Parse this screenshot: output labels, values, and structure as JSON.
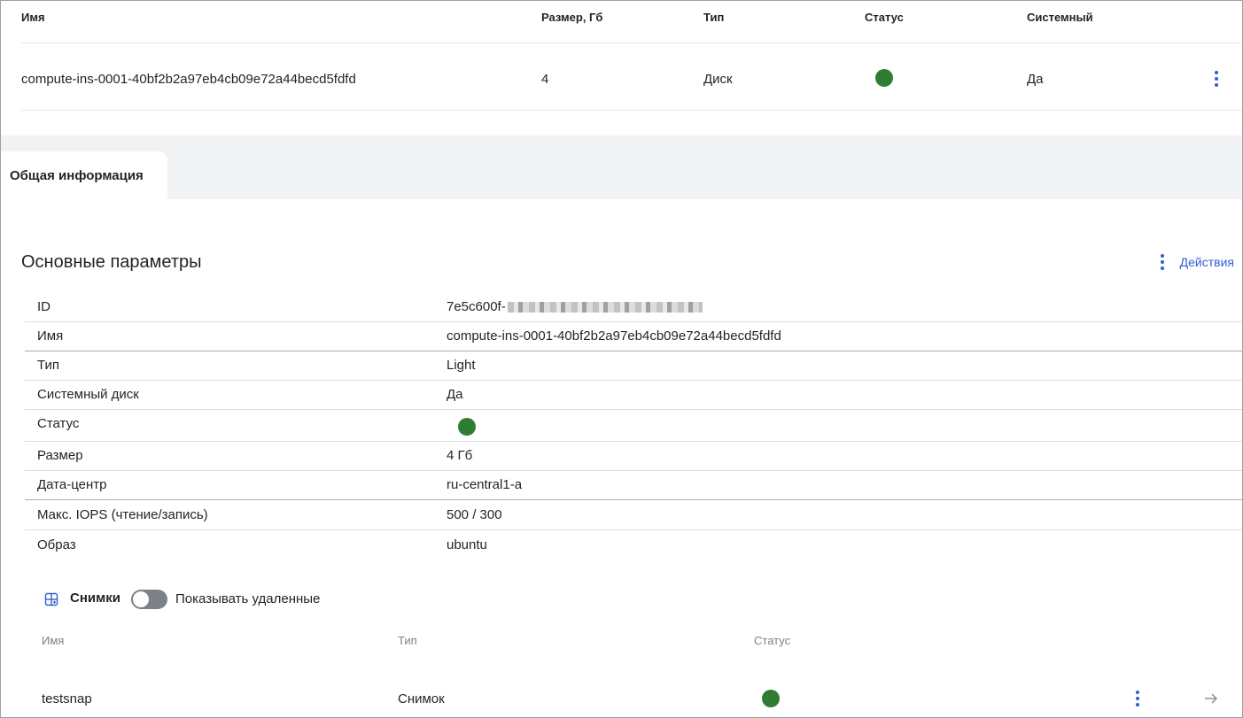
{
  "disk_table": {
    "headers": [
      "Имя",
      "Размер, Гб",
      "Тип",
      "Статус",
      "Системный"
    ],
    "row": {
      "name": "compute-ins-0001-40bf2b2a97eb4cb09e72a44becd5fdfd",
      "size": "4",
      "type": "Диск",
      "status": "active",
      "system": "Да"
    }
  },
  "tabs": [
    {
      "label": "Общая информация",
      "active": true
    }
  ],
  "section": {
    "title": "Основные параметры",
    "actions_label": "Действия"
  },
  "params": [
    {
      "key": "ID",
      "value": "7e5c600f-"
    },
    {
      "key": "Имя",
      "value": "compute-ins-0001-40bf2b2a97eb4cb09e72a44becd5fdfd"
    },
    {
      "key": "Тип",
      "value": "Light"
    },
    {
      "key": "Системный диск",
      "value": "Да"
    },
    {
      "key": "Статус",
      "value": ""
    },
    {
      "key": "Размер",
      "value": "4 Гб"
    },
    {
      "key": "Дата-центр",
      "value": "ru-central1-a"
    },
    {
      "key": "Макс. IOPS (чтение/запись)",
      "value": "500 / 300"
    },
    {
      "key": "Образ",
      "value": "ubuntu"
    }
  ],
  "snapshots": {
    "title": "Снимки",
    "toggle_label": "Показывать удаленные",
    "toggle_on": false,
    "headers": [
      "Имя",
      "Тип",
      "Статус"
    ],
    "rows": [
      {
        "name": "testsnap",
        "type": "Снимок",
        "status": "active"
      }
    ]
  },
  "colors": {
    "status_active": "#2e7d32",
    "accent": "#2f5fd0"
  },
  "icons": [
    "kebab-menu-icon",
    "snapshots-table-icon",
    "arrow-right-icon"
  ]
}
